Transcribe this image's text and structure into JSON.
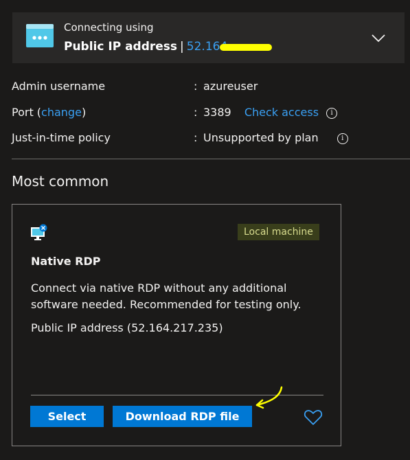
{
  "connection": {
    "subtitle": "Connecting using",
    "method": "Public IP address",
    "separator": "|",
    "ip_partial": "52.164"
  },
  "properties": {
    "admin_label": "Admin username",
    "admin_value": "azureuser",
    "port_label_prefix": "Port (",
    "port_change_link": "change",
    "port_label_suffix": ")",
    "port_value": "3389",
    "check_access_link": "Check access",
    "jit_label": "Just-in-time policy",
    "jit_value": "Unsupported by plan",
    "colon": ":"
  },
  "section_title": "Most common",
  "card": {
    "badge": "Local machine",
    "title": "Native RDP",
    "description": "Connect via native RDP without any additional software needed. Recommended for testing only.",
    "ip_text": "Public IP address (52.164.217.235)",
    "select_label": "Select",
    "download_label": "Download RDP file"
  },
  "icons": {
    "info": "i",
    "heart": "heart-icon",
    "chevron": "chevron-down-icon"
  },
  "colors": {
    "accent": "#0078d4",
    "link": "#3aa0f3",
    "highlight_annotation": "#ffff00"
  }
}
